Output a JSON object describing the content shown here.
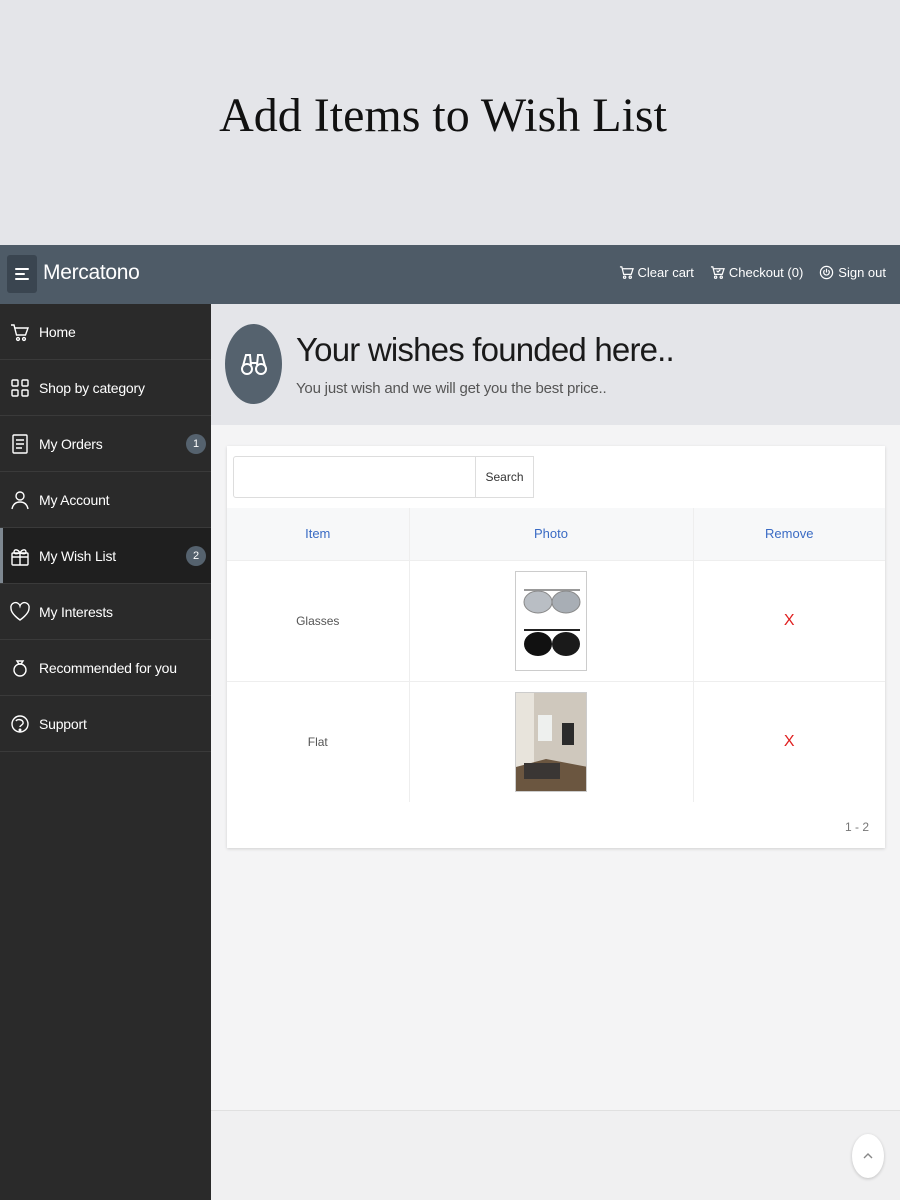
{
  "banner": {
    "title": "Add Items to Wish List"
  },
  "app": {
    "brand": "Mercatono"
  },
  "topbar": {
    "actions": [
      {
        "label": "Clear cart",
        "icon": "cart-icon"
      },
      {
        "label": "Checkout (0)",
        "icon": "cart-check-icon"
      },
      {
        "label": "Sign out",
        "icon": "power-icon"
      }
    ]
  },
  "sidebar": {
    "items": [
      {
        "label": "Home",
        "icon": "home-cart-icon",
        "badge": ""
      },
      {
        "label": "Shop by category",
        "icon": "grid-icon",
        "badge": ""
      },
      {
        "label": "My Orders",
        "icon": "receipt-icon",
        "badge": "1"
      },
      {
        "label": "My Account",
        "icon": "user-icon",
        "badge": ""
      },
      {
        "label": "My Wish List",
        "icon": "gift-icon",
        "badge": "2",
        "active": true
      },
      {
        "label": "My Interests",
        "icon": "heart-icon",
        "badge": ""
      },
      {
        "label": "Recommended for you",
        "icon": "ring-icon",
        "badge": ""
      },
      {
        "label": "Support",
        "icon": "support-icon",
        "badge": ""
      }
    ]
  },
  "hero": {
    "icon": "binoculars-icon",
    "title": "Your wishes founded here..",
    "subtitle": "You just wish and we will get you the best price.."
  },
  "search": {
    "placeholder": "",
    "value": "",
    "button_label": "Search"
  },
  "table": {
    "headers": [
      "Item",
      "Photo",
      "Remove"
    ],
    "rows": [
      {
        "item": "Glasses",
        "photo": "sunglasses-photo",
        "remove": "X"
      },
      {
        "item": "Flat",
        "photo": "flat-interior-photo",
        "remove": "X"
      }
    ]
  },
  "pager": {
    "text": "1 - 2"
  },
  "colors": {
    "topbar": "#4e5b67",
    "sidebar": "#2a2a2a",
    "header_link": "#3a6bc4",
    "remove": "#e02020"
  }
}
